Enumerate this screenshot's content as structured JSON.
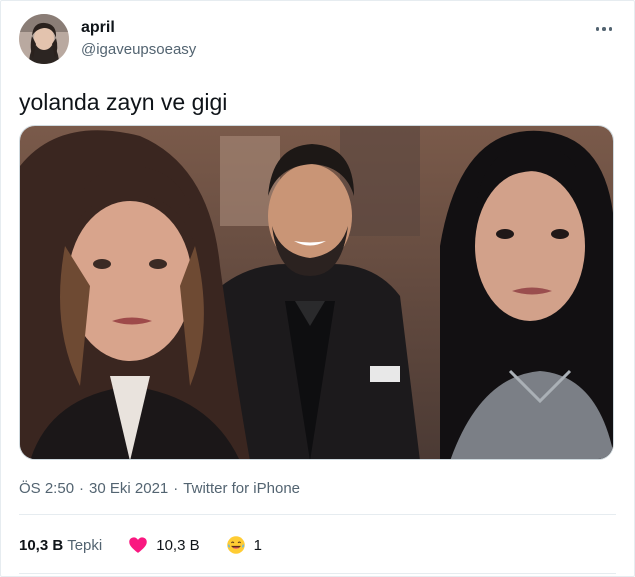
{
  "user": {
    "name": "april",
    "handle": "@igaveupsoeasy",
    "avatar_icon": "profile-photo"
  },
  "tweet": {
    "text": "yolanda zayn ve gigi",
    "media_description_icon": "photo-collage"
  },
  "meta": {
    "time": "ÖS 2:50",
    "sep1": "·",
    "date": "30 Eki 2021",
    "sep2": "·",
    "client": "Twitter for iPhone"
  },
  "stats": {
    "retweet_count": "10,3 B",
    "retweet_label": "Tepki",
    "like_count": "10,3 B",
    "laugh_count": "1"
  },
  "icons": {
    "more": "more-dots-icon",
    "heart": "heart-icon",
    "laugh": "laugh-emoji-icon"
  },
  "colors": {
    "text_primary": "#0f1419",
    "text_secondary": "#536471",
    "heart": "#f91880",
    "border": "#e6ecf0"
  }
}
